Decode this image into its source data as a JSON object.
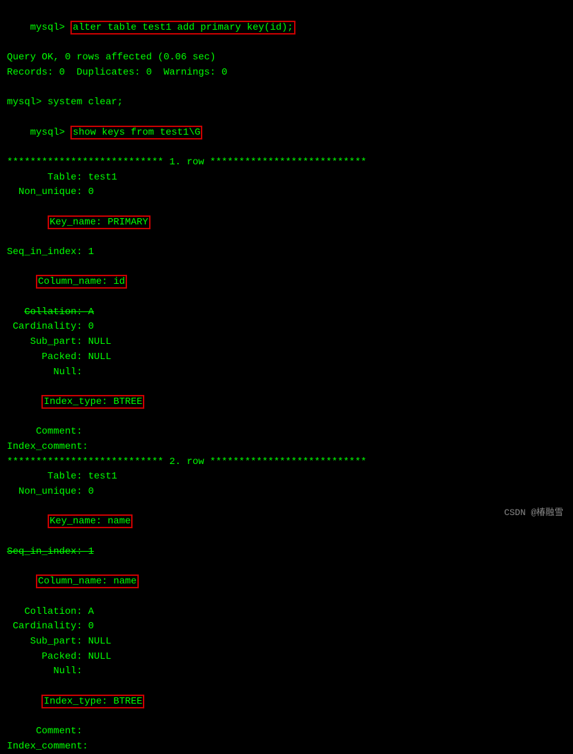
{
  "terminal": {
    "lines": [
      {
        "type": "prompt-cmd",
        "prompt": "mysql> ",
        "cmd_plain": "",
        "cmd_highlighted": "alter table test1 add primary key(id);",
        "highlight": true
      },
      {
        "type": "plain",
        "text": "Query OK, 0 rows affected (0.06 sec)"
      },
      {
        "type": "plain",
        "text": "Records: 0  Duplicates: 0  Warnings: 0"
      },
      {
        "type": "blank",
        "text": ""
      },
      {
        "type": "prompt-plain",
        "text": "mysql> system clear;"
      },
      {
        "type": "prompt-cmd",
        "prompt": "mysql> ",
        "cmd_plain": "",
        "cmd_highlighted": "show keys from test1\\G",
        "highlight": true
      },
      {
        "type": "plain",
        "text": "*************************** 1. row ***************************"
      },
      {
        "type": "indented",
        "text": "       Table: test1"
      },
      {
        "type": "indented",
        "text": "  Non_unique: 0"
      },
      {
        "type": "indented-highlight",
        "label": "   Key_name: ",
        "value": "PRIMARY",
        "highlight": true
      },
      {
        "type": "indented",
        "text": "Seq_in_index: 1"
      },
      {
        "type": "indented-highlight",
        "label": " Column_name: ",
        "value": "id",
        "highlight": true
      },
      {
        "type": "indented-strikethrough",
        "text": "   Collation: A"
      },
      {
        "type": "indented",
        "text": " Cardinality: 0"
      },
      {
        "type": "indented",
        "text": "    Sub_part: NULL"
      },
      {
        "type": "indented",
        "text": "      Packed: NULL"
      },
      {
        "type": "indented",
        "text": "        Null:"
      },
      {
        "type": "indented-highlight",
        "label": "  Index_type: ",
        "value": "BTREE",
        "highlight": true
      },
      {
        "type": "indented",
        "text": "     Comment:"
      },
      {
        "type": "plain",
        "text": "Index_comment:"
      },
      {
        "type": "plain",
        "text": "*************************** 2. row ***************************"
      },
      {
        "type": "indented",
        "text": "       Table: test1"
      },
      {
        "type": "indented",
        "text": "  Non_unique: 0"
      },
      {
        "type": "indented-highlight",
        "label": "   Key_name: ",
        "value": "name",
        "highlight": true
      },
      {
        "type": "indented-strikethrough",
        "text": "Seq_in_index: 1"
      },
      {
        "type": "indented-highlight",
        "label": " Column_name: ",
        "value": "name",
        "highlight": true
      },
      {
        "type": "indented",
        "text": "   Collation: A"
      },
      {
        "type": "indented",
        "text": " Cardinality: 0"
      },
      {
        "type": "indented",
        "text": "    Sub_part: NULL"
      },
      {
        "type": "indented",
        "text": "      Packed: NULL"
      },
      {
        "type": "indented",
        "text": "        Null:"
      },
      {
        "type": "indented-highlight",
        "label": "  Index_type: ",
        "value": "BTREE",
        "highlight": true
      },
      {
        "type": "indented",
        "text": "     Comment:"
      },
      {
        "type": "plain",
        "text": "Index_comment:"
      }
    ],
    "watermark": "CSDN @椿融雪"
  }
}
